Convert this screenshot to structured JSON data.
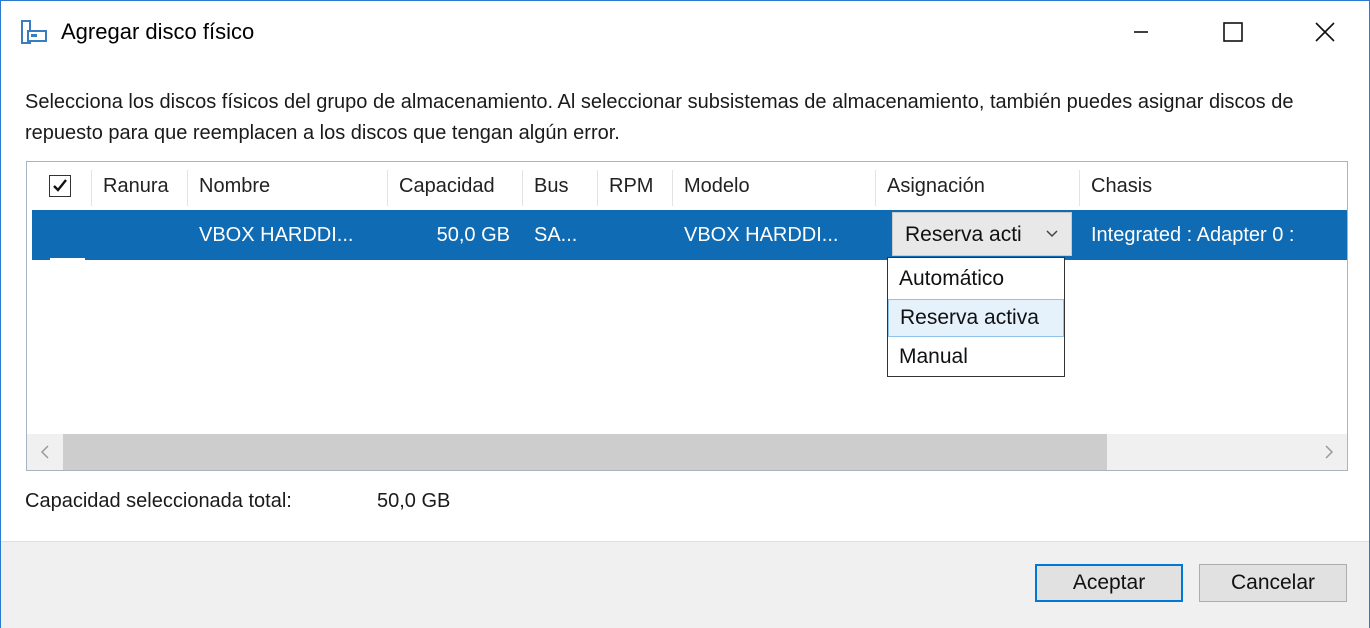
{
  "window": {
    "title": "Agregar disco físico"
  },
  "instructions": "Selecciona los discos físicos del grupo de almacenamiento. Al seleccionar subsistemas de almacenamiento, también puedes asignar discos de repuesto para que reemplacen a los discos que tengan algún error.",
  "grid": {
    "columns": [
      "Ranura",
      "Nombre",
      "Capacidad",
      "Bus",
      "RPM",
      "Modelo",
      "Asignación",
      "Chasis"
    ],
    "rows": [
      {
        "checked": true,
        "ranura": "",
        "nombre": "VBOX HARDDI...",
        "capacidad": "50,0 GB",
        "bus": "SA...",
        "rpm": "",
        "modelo": "VBOX HARDDI...",
        "asignacion": "Reserva acti",
        "chasis": "Integrated : Adapter 0 :"
      }
    ]
  },
  "dropdown": {
    "options": [
      "Automático",
      "Reserva activa",
      "Manual"
    ],
    "highlighted": "Reserva activa"
  },
  "summary": {
    "label": "Capacidad seleccionada total:",
    "value": "50,0 GB"
  },
  "buttons": {
    "ok": "Aceptar",
    "cancel": "Cancelar"
  },
  "colors": {
    "selection": "#0f6bb3",
    "accent": "#0078d7"
  }
}
